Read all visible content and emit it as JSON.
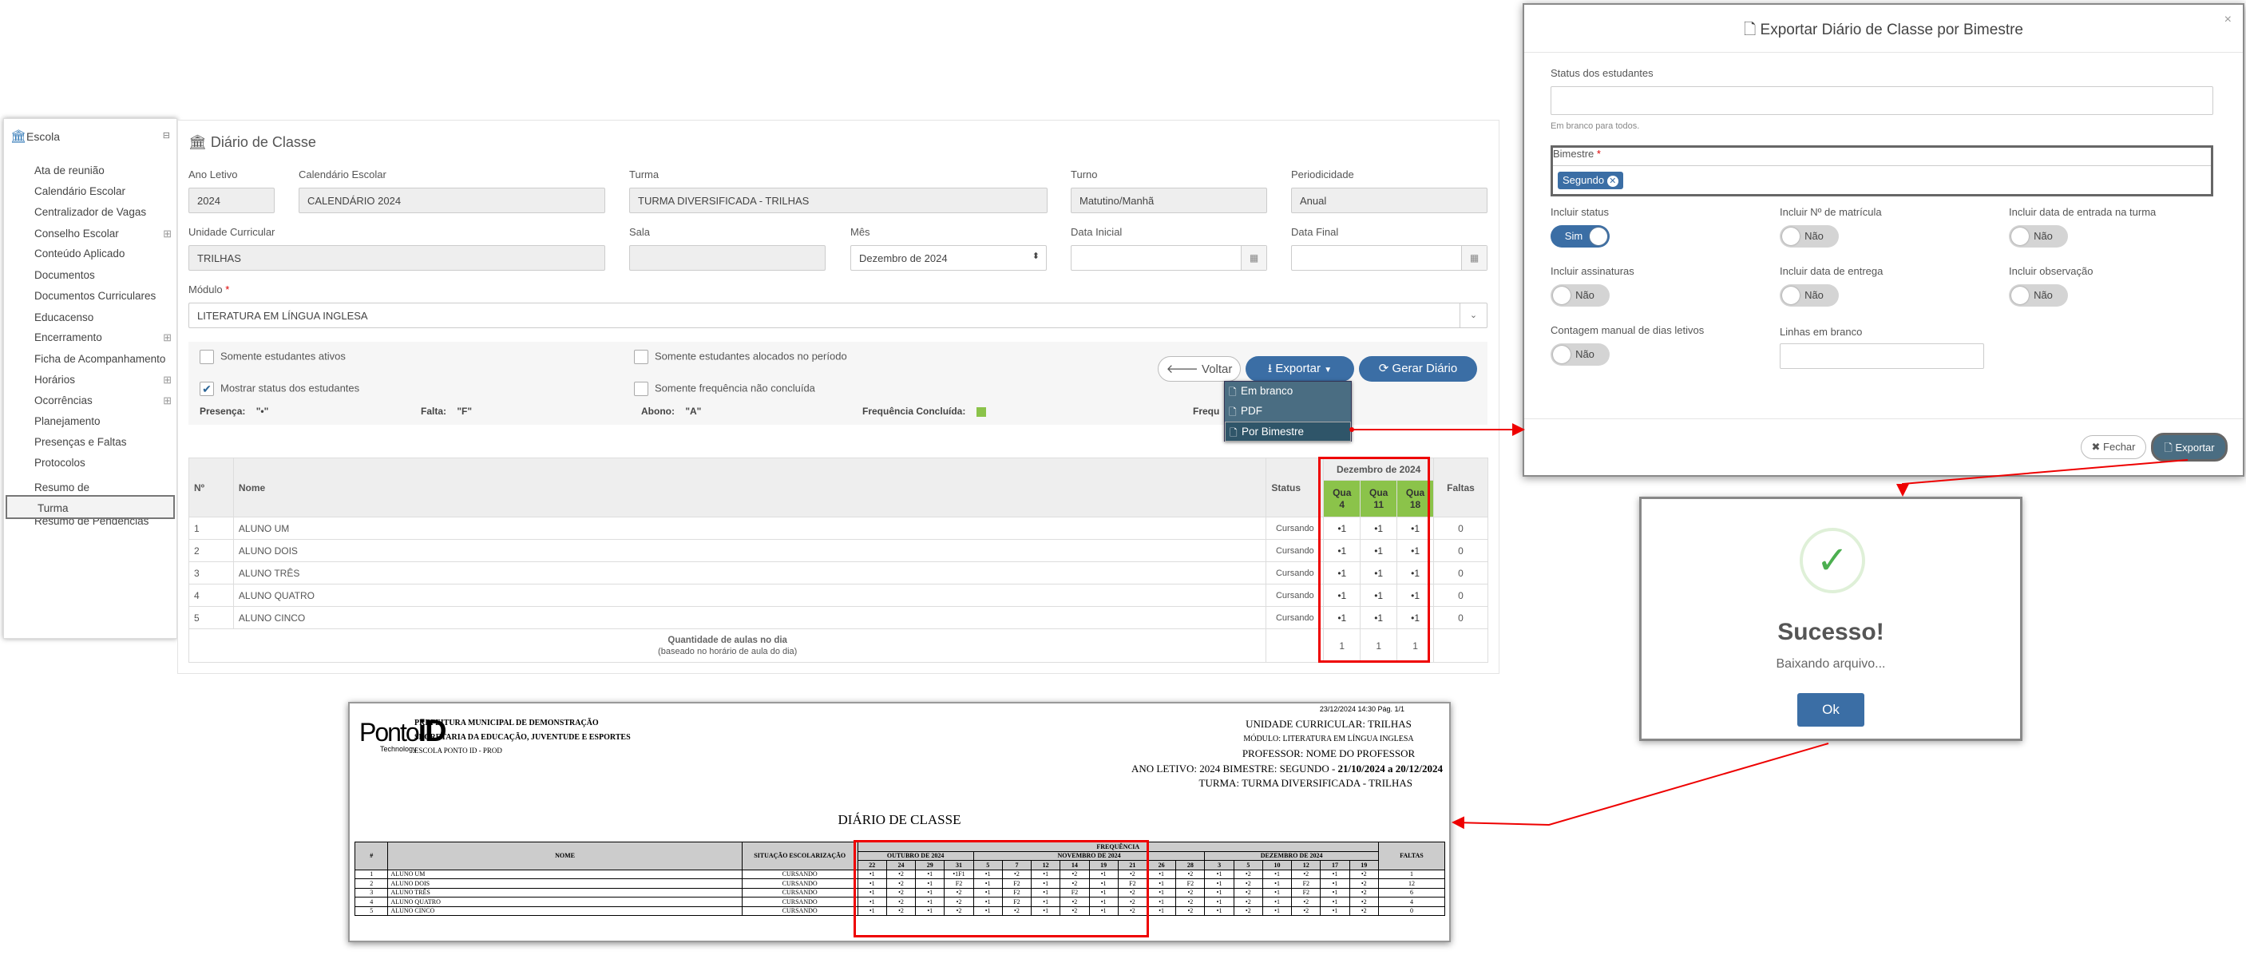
{
  "sidebar": {
    "header": "Escola",
    "items": [
      {
        "label": "Ata de reunião",
        "plus": false
      },
      {
        "label": "Calendário Escolar",
        "plus": false
      },
      {
        "label": "Centralizador de Vagas",
        "plus": false
      },
      {
        "label": "Conselho Escolar",
        "plus": true
      },
      {
        "label": "Conteúdo Aplicado",
        "plus": false
      },
      {
        "label": "Documentos",
        "plus": false
      },
      {
        "label": "Documentos Curriculares",
        "plus": false
      },
      {
        "label": "Educacenso",
        "plus": false
      },
      {
        "label": "Encerramento",
        "plus": true
      },
      {
        "label": "Ficha de Acompanhamento",
        "plus": false
      },
      {
        "label": "Horários",
        "plus": true
      },
      {
        "label": "Ocorrências",
        "plus": true
      },
      {
        "label": "Planejamento",
        "plus": false
      },
      {
        "label": "Presenças e Faltas",
        "plus": false
      },
      {
        "label": "Protocolos",
        "plus": false
      },
      {
        "label": "Resumo de Aproveitamento",
        "plus": false
      },
      {
        "label": "Resumo de Pendências",
        "plus": false
      },
      {
        "label": "Turma",
        "plus": false
      }
    ]
  },
  "page": {
    "title": "Diário de Classe"
  },
  "form": {
    "ano_letivo": {
      "label": "Ano Letivo",
      "value": "2024"
    },
    "calendario": {
      "label": "Calendário Escolar",
      "value": "CALENDÁRIO 2024"
    },
    "turma": {
      "label": "Turma",
      "value": "TURMA DIVERSIFICADA - TRILHAS"
    },
    "turno": {
      "label": "Turno",
      "value": "Matutino/Manhã"
    },
    "periodicidade": {
      "label": "Periodicidade",
      "value": "Anual"
    },
    "unidade": {
      "label": "Unidade Curricular",
      "value": "TRILHAS"
    },
    "sala": {
      "label": "Sala",
      "value": ""
    },
    "mes": {
      "label": "Mês",
      "value": "Dezembro de 2024"
    },
    "data_inicial": {
      "label": "Data Inicial",
      "value": ""
    },
    "data_final": {
      "label": "Data Final",
      "value": ""
    },
    "modulo": {
      "label": "Módulo",
      "required": "*",
      "value": "LITERATURA EM LÍNGUA INGLESA"
    }
  },
  "filters": {
    "ativos": "Somente estudantes ativos",
    "alocados": "Somente estudantes alocados no período",
    "status": "Mostrar status dos estudantes",
    "freq": "Somente frequência não concluída"
  },
  "legend": {
    "presenca": "Presença:",
    "presenca_v": "\"•\"",
    "falta": "Falta:",
    "falta_v": "\"F\"",
    "abono": "Abono:",
    "abono_v": "\"A\"",
    "concluida": "Frequência Concluída:",
    "freq_cut": "Frequ"
  },
  "buttons": {
    "voltar": "Voltar",
    "exportar": "Exportar",
    "gerar": "Gerar Diário"
  },
  "dropdown": [
    "Em branco",
    "PDF",
    "Por Bimestre"
  ],
  "table": {
    "col_n": "Nº",
    "col_nome": "Nome",
    "col_status": "Status",
    "col_month": "Dezembro de 2024",
    "col_faltas": "Faltas",
    "days": [
      {
        "d": "Qua",
        "n": "4"
      },
      {
        "d": "Qua",
        "n": "11"
      },
      {
        "d": "Qua",
        "n": "18"
      }
    ],
    "rows": [
      {
        "n": "1",
        "nome": "ALUNO UM",
        "status": "Cursando",
        "marks": [
          "•1",
          "•1",
          "•1"
        ],
        "faltas": "0"
      },
      {
        "n": "2",
        "nome": "ALUNO DOIS",
        "status": "Cursando",
        "marks": [
          "•1",
          "•1",
          "•1"
        ],
        "faltas": "0"
      },
      {
        "n": "3",
        "nome": "ALUNO TRÊS",
        "status": "Cursando",
        "marks": [
          "•1",
          "•1",
          "•1"
        ],
        "faltas": "0"
      },
      {
        "n": "4",
        "nome": "ALUNO QUATRO",
        "status": "Cursando",
        "marks": [
          "•1",
          "•1",
          "•1"
        ],
        "faltas": "0"
      },
      {
        "n": "5",
        "nome": "ALUNO CINCO",
        "status": "Cursando",
        "marks": [
          "•1",
          "•1",
          "•1"
        ],
        "faltas": "0"
      }
    ],
    "footer_label": "Quantidade de aulas no dia",
    "footer_sub": "(baseado no horário de aula do dia)",
    "footer_vals": [
      "1",
      "1",
      "1"
    ]
  },
  "modal": {
    "title": "Exportar Diário de Classe por Bimestre",
    "close": "×",
    "status_label": "Status dos estudantes",
    "status_help": "Em branco para todos.",
    "bimestre_label": "Bimestre",
    "bimestre_req": "*",
    "bimestre_tag": "Segundo",
    "toggles": [
      {
        "label": "Incluir status",
        "value": "Sim"
      },
      {
        "label": "Incluir Nº de matrícula",
        "value": "Não"
      },
      {
        "label": "Incluir data de entrada na turma",
        "value": "Não"
      },
      {
        "label": "Incluir assinaturas",
        "value": "Não"
      },
      {
        "label": "Incluir data de entrega",
        "value": "Não"
      },
      {
        "label": "Incluir observação",
        "value": "Não"
      },
      {
        "label": "Contagem manual de dias letivos",
        "value": "Não"
      }
    ],
    "linhas_label": "Linhas em branco",
    "fechar": "Fechar",
    "exportar": "Exportar"
  },
  "success": {
    "title": "Sucesso!",
    "text": "Baixando arquivo...",
    "ok": "Ok"
  },
  "pdf": {
    "stamp": "23/12/2024 14:30  Pág. 1/1",
    "logo": "Ponto",
    "logo2": "iD",
    "logo_sub": "Technology",
    "org1": "PREFEITURA MUNICIPAL DE DEMONSTRAÇÃO",
    "org2": "SECRETARIA DA EDUCAÇÃO, JUVENTUDE E ESPORTES",
    "org3": "ESCOLA PONTO ID - PROD",
    "info1": "UNIDADE CURRICULAR: TRILHAS",
    "info2": "MÓDULO: LITERATURA EM LÍNGUA INGLESA",
    "info3": "PROFESSOR: NOME DO PROFESSOR",
    "info4a": "ANO LETIVO: 2024    BIMESTRE: SEGUNDO - ",
    "info4b": "21/10/2024 a 20/12/2024",
    "info5": "TURMA: TURMA DIVERSIFICADA - TRILHAS",
    "doc_title": "DIÁRIO DE CLASSE",
    "h_num": "#",
    "h_nome": "NOME",
    "h_sit": "SITUAÇÃO ESCOLARIZAÇÃO",
    "h_freq": "FREQUÊNCIA",
    "h_faltas": "FALTAS",
    "months": [
      {
        "name": "OUTUBRO DE 2024",
        "days": [
          "22",
          "24",
          "29",
          "31"
        ]
      },
      {
        "name": "NOVEMBRO DE 2024",
        "days": [
          "5",
          "7",
          "12",
          "14",
          "19",
          "21",
          "26",
          "28"
        ]
      },
      {
        "name": "DEZEMBRO DE 2024",
        "days": [
          "3",
          "5",
          "10",
          "12",
          "17",
          "19"
        ]
      }
    ],
    "rows": [
      {
        "n": "1",
        "nome": "ALUNO UM",
        "sit": "CURSANDO",
        "cells": [
          "•1",
          "•2",
          "•1",
          "•1F1",
          "•1",
          "•2",
          "•1",
          "•2",
          "•1",
          "•2",
          "•1",
          "•2",
          "•1",
          "•2",
          "•1",
          "•2",
          "•1",
          "•2"
        ],
        "faltas": "1"
      },
      {
        "n": "2",
        "nome": "ALUNO DOIS",
        "sit": "CURSANDO",
        "cells": [
          "•1",
          "•2",
          "•1",
          "F2",
          "•1",
          "F2",
          "•1",
          "•2",
          "•1",
          "F2",
          "•1",
          "F2",
          "•1",
          "•2",
          "•1",
          "F2",
          "•1",
          "•2"
        ],
        "faltas": "12"
      },
      {
        "n": "3",
        "nome": "ALUNO TRÊS",
        "sit": "CURSANDO",
        "cells": [
          "•1",
          "•2",
          "•1",
          "•2",
          "•1",
          "F2",
          "•1",
          "F2",
          "•1",
          "•2",
          "•1",
          "•2",
          "•1",
          "•2",
          "•1",
          "F2",
          "•1",
          "•2"
        ],
        "faltas": "6"
      },
      {
        "n": "4",
        "nome": "ALUNO QUATRO",
        "sit": "CURSANDO",
        "cells": [
          "•1",
          "•2",
          "•1",
          "•2",
          "•1",
          "F2",
          "•1",
          "•2",
          "•1",
          "•2",
          "•1",
          "•2",
          "•1",
          "•2",
          "•1",
          "•2",
          "•1",
          "•2"
        ],
        "faltas": "4"
      },
      {
        "n": "5",
        "nome": "ALUNO CINCO",
        "sit": "CURSANDO",
        "cells": [
          "•1",
          "•2",
          "•1",
          "•2",
          "•1",
          "•2",
          "•1",
          "•2",
          "•1",
          "•2",
          "•1",
          "•2",
          "•1",
          "•2",
          "•1",
          "•2",
          "•1",
          "•2"
        ],
        "faltas": "0"
      }
    ]
  },
  "colors": {
    "primary": "#3b6ea5",
    "red": "#e00000",
    "green": "#8bc34a",
    "success": "#4caf50"
  }
}
